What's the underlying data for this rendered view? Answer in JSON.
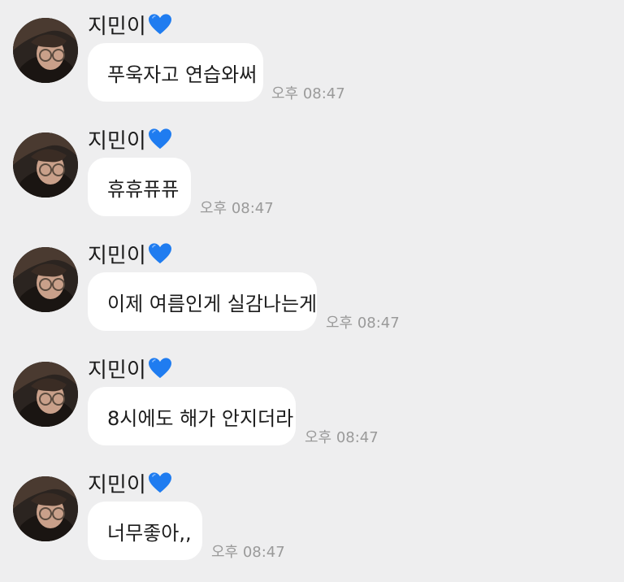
{
  "chat": {
    "messages": [
      {
        "sender": "지민이",
        "sender_emoji": "blue-heart",
        "text": "푸욱자고 연습와써",
        "time": "오후 08:47"
      },
      {
        "sender": "지민이",
        "sender_emoji": "blue-heart",
        "text": "휴휴퓨퓨",
        "time": "오후 08:47"
      },
      {
        "sender": "지민이",
        "sender_emoji": "blue-heart",
        "text": "이제 여름인게 실감나는게",
        "time": "오후 08:47"
      },
      {
        "sender": "지민이",
        "sender_emoji": "blue-heart",
        "text": "8시에도 해가 안지더라",
        "time": "오후 08:47"
      },
      {
        "sender": "지민이",
        "sender_emoji": "blue-heart",
        "text": "너무좋아,,",
        "time": "오후 08:47"
      }
    ]
  },
  "colors": {
    "background": "#eeeeef",
    "bubble": "#ffffff",
    "heart": "#1f7cf0",
    "timestamp": "#9a9a9a"
  }
}
